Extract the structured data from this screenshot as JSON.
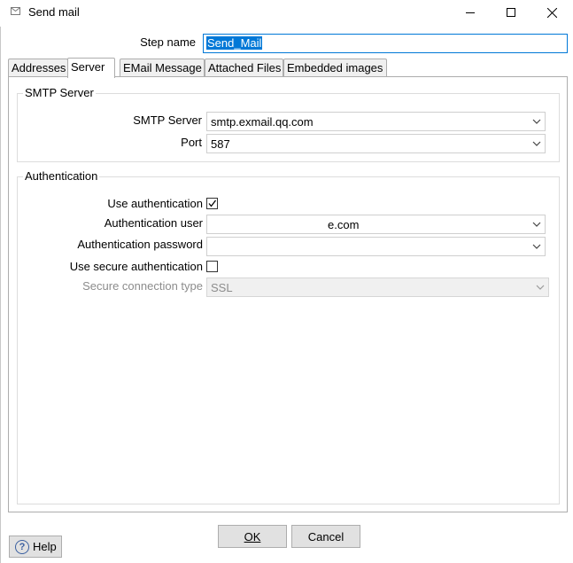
{
  "window": {
    "title": "Send mail",
    "controls": {
      "minimize_icon": "minimize-icon",
      "maximize_icon": "maximize-icon",
      "close_icon": "close-icon"
    }
  },
  "step_name": {
    "label": "Step name",
    "value": "Send_Mail"
  },
  "tabs": [
    {
      "label": "Addresses",
      "active": false
    },
    {
      "label": "Server",
      "active": true
    },
    {
      "label": "EMail Message",
      "active": false
    },
    {
      "label": "Attached Files",
      "active": false
    },
    {
      "label": "Embedded images",
      "active": false
    }
  ],
  "smtp_group": {
    "title": "SMTP Server",
    "server_label": "SMTP Server",
    "server_value": "smtp.exmail.qq.com",
    "port_label": "Port",
    "port_value": "587"
  },
  "auth_group": {
    "title": "Authentication",
    "use_auth_label": "Use authentication",
    "use_auth_checked": true,
    "user_label": "Authentication user",
    "user_value": "e.com",
    "password_label": "Authentication password",
    "password_value": "",
    "secure_auth_label": "Use secure authentication",
    "secure_auth_checked": false,
    "conn_type_label": "Secure connection type",
    "conn_type_value": "SSL"
  },
  "footer": {
    "help_label": "Help",
    "ok_label": "OK",
    "cancel_label": "Cancel"
  },
  "colors": {
    "selection": "#0078d7",
    "button_face": "#e1e1e1",
    "border": "#adadad"
  }
}
